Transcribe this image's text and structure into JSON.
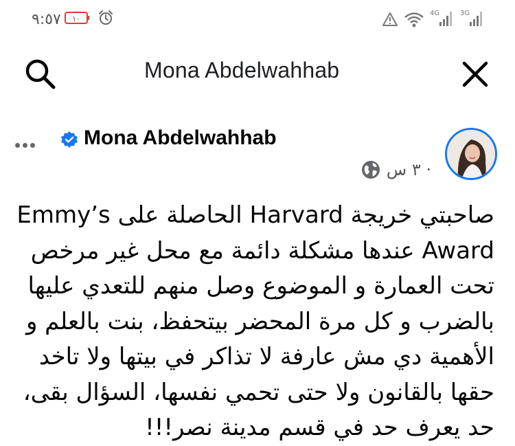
{
  "status_bar": {
    "time": "٩:٥٧",
    "battery_level": "١٠",
    "battery_color": "#e53935",
    "icons": [
      "battery-icon",
      "alarm-icon",
      "warning-icon",
      "wifi-icon",
      "signal-4g-icon",
      "signal-3g-icon"
    ],
    "network_1": "4G",
    "network_2": "3G"
  },
  "header": {
    "title": "Mona Abdelwahhab",
    "icons": [
      "search-icon",
      "close-icon"
    ]
  },
  "post": {
    "author": "Mona Abdelwahhab",
    "verified": true,
    "time": "٣ س ·",
    "privacy_icon": "globe-icon",
    "accent_color": "#1877f2",
    "lines": [
      "صاحبتي خريجة Harvard الحاصلة على Emmy’s",
      "Award  عندها مشكلة دائمة مع محل غير مرخص",
      "تحت العمارة و الموضوع وصل منهم للتعدي عليها",
      "بالضرب و كل مرة المحضر بيتحفظ، بنت بالعلم و",
      "الأهمية دي مش عارفة لا تذاكر في بيتها ولا تاخد",
      "حقها بالقانون ولا حتى تحمي نفسها، السؤال بقى،",
      "حد يعرف حد في قسم مدينة نصر!!!"
    ]
  }
}
